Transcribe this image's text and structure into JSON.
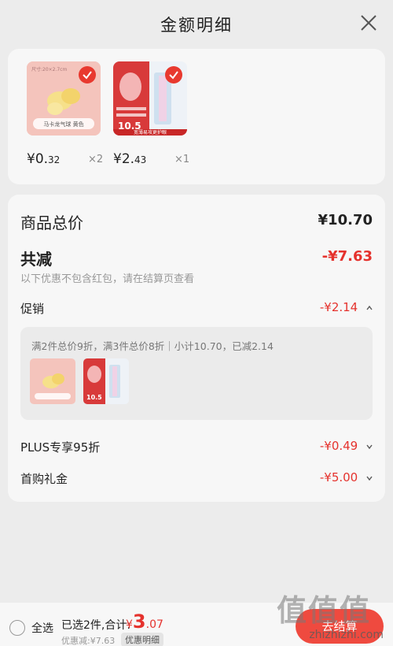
{
  "header": {
    "title": "金额明细",
    "close_icon": "close-icon"
  },
  "products": [
    {
      "image_label": "马卡龙气球 黄色",
      "price_int": "¥0.",
      "price_dec": "32",
      "qty": "×2"
    },
    {
      "image_label": "宽薄易攻更护眼",
      "price_int": "¥2.",
      "price_dec": "43",
      "qty": "×1"
    }
  ],
  "summary": {
    "goods_total_label": "商品总价",
    "goods_total_value": "¥10.70",
    "discount_label": "共减",
    "discount_value": "-¥7.63",
    "discount_note": "以下优惠不包含红包，请在结算页查看"
  },
  "promo": {
    "label": "促销",
    "value": "-¥2.14",
    "desc": "满2件总价9折，满3件总价8折｜小计10.70，已减2.14"
  },
  "plus": {
    "label": "PLUS专享95折",
    "value": "-¥0.49"
  },
  "first_gift": {
    "label": "首购礼金",
    "value": "-¥5.00"
  },
  "footer": {
    "select_all": "全选",
    "selected_text": "已选2件,合计:",
    "total_symbol": "¥",
    "total_int": "3",
    "total_dec": ".07",
    "saved_text": "优惠减:¥7.63",
    "detail_btn": "优惠明细",
    "pay_btn": "去结算"
  },
  "watermark": {
    "logo": "值值值",
    "site": "zhizhizhi.com"
  },
  "colors": {
    "accent": "#e5322d",
    "bg": "#ececec",
    "card": "#f7f7f7"
  }
}
